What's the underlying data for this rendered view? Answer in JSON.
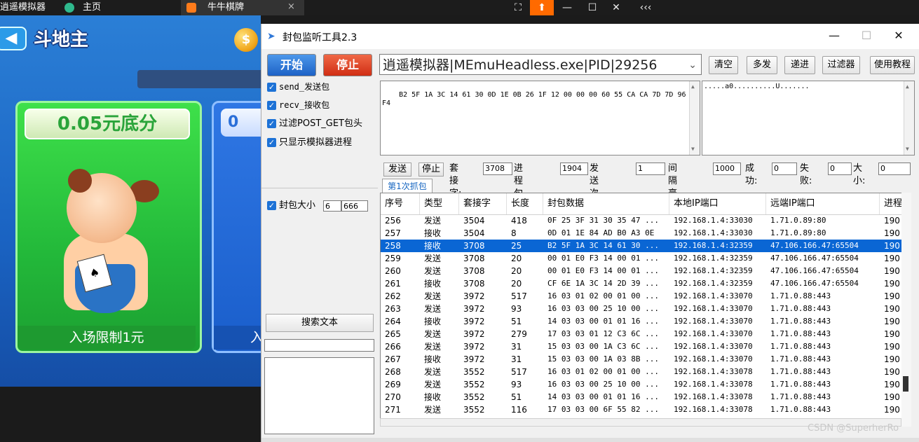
{
  "taskbar": {
    "tab1": "逍遥模拟器",
    "tab2": "主页",
    "tab3": "牛牛棋牌",
    "close_glyph": "×",
    "btn_fullscreen": "⛶",
    "btn_upload": "⬆",
    "btn_min": "—",
    "btn_max": "☐",
    "btn_close": "✕",
    "btn_more": "‹‹‹"
  },
  "game": {
    "title": "斗地主",
    "coin_glyph": "$",
    "card1_title": "0.05元底分",
    "card1_footer": "入场限制1元",
    "card2_title": "0",
    "card2_footer": "入"
  },
  "window": {
    "title": "封包监听工具2.3",
    "minimize": "—",
    "maximize": "☐",
    "close": "✕"
  },
  "controls": {
    "start": "开始",
    "stop": "停止",
    "chk_send": "send_发送包",
    "chk_recv": "recv_接收包",
    "chk_filter": "过滤POST_GET包头",
    "chk_emulator": "只显示模拟器进程",
    "chk_size": "封包大小",
    "size_min": "6",
    "size_max": "666",
    "search_text": "搜索文本"
  },
  "process": {
    "selected": "逍遥模拟器|MEmuHeadless.exe|PID|29256"
  },
  "toolbar": {
    "clear": "清空",
    "multi_send": "多发",
    "forward": "递进",
    "filter": "过滤器",
    "tutorial": "使用教程"
  },
  "packet_detail": {
    "hex": "B2 5F 1A 3C 14 61 30 0D 1E 0B 26 1F 12 00 00 00 60 55 CA CA 7D 7D 96 A2 F4",
    "ascii": ".....a0..........U......."
  },
  "send_row": {
    "send": "发送",
    "stop": "停止",
    "socket_label": "套接字:",
    "socket_val": "3708",
    "handle_label": "进程句柄:",
    "handle_val": "1904",
    "count_label": "发送次数:",
    "count_val": "1",
    "interval_label": "间隔毫秒:",
    "interval_val": "1000",
    "success_label": "成功:",
    "success_val": "0",
    "fail_label": "失败:",
    "fail_val": "0",
    "size_label": "大小:",
    "size_val": "0"
  },
  "capture_tab": "第1次抓包",
  "table": {
    "headers": [
      "序号",
      "类型",
      "套接字",
      "长度",
      "封包数据",
      "本地IP端口",
      "远端IP端口",
      "进程"
    ],
    "rows": [
      [
        "256",
        "发送",
        "3504",
        "418",
        "0F 25 3F 31 30 35 47 ...",
        "192.168.1.4:33030",
        "1.71.0.89:80",
        "190"
      ],
      [
        "257",
        "接收",
        "3504",
        "8",
        "0D 01 1E 84 AD B0 A3 0E",
        "192.168.1.4:33030",
        "1.71.0.89:80",
        "190"
      ],
      [
        "258",
        "接收",
        "3708",
        "25",
        "B2 5F 1A 3C 14 61 30 ...",
        "192.168.1.4:32359",
        "47.106.166.47:65504",
        "190"
      ],
      [
        "259",
        "发送",
        "3708",
        "20",
        "00 01 E0 F3 14 00 01 ...",
        "192.168.1.4:32359",
        "47.106.166.47:65504",
        "190"
      ],
      [
        "260",
        "发送",
        "3708",
        "20",
        "00 01 E0 F3 14 00 01 ...",
        "192.168.1.4:32359",
        "47.106.166.47:65504",
        "190"
      ],
      [
        "261",
        "接收",
        "3708",
        "20",
        "CF 6E 1A 3C 14 2D 39 ...",
        "192.168.1.4:32359",
        "47.106.166.47:65504",
        "190"
      ],
      [
        "262",
        "发送",
        "3972",
        "517",
        "16 03 01 02 00 01 00 ...",
        "192.168.1.4:33070",
        "1.71.0.88:443",
        "190"
      ],
      [
        "263",
        "发送",
        "3972",
        "93",
        "16 03 03 00 25 10 00 ...",
        "192.168.1.4:33070",
        "1.71.0.88:443",
        "190"
      ],
      [
        "264",
        "接收",
        "3972",
        "51",
        "14 03 03 00 01 01 16 ...",
        "192.168.1.4:33070",
        "1.71.0.88:443",
        "190"
      ],
      [
        "265",
        "发送",
        "3972",
        "279",
        "17 03 03 01 12 C3 6C ...",
        "192.168.1.4:33070",
        "1.71.0.88:443",
        "190"
      ],
      [
        "266",
        "发送",
        "3972",
        "31",
        "15 03 03 00 1A C3 6C ...",
        "192.168.1.4:33070",
        "1.71.0.88:443",
        "190"
      ],
      [
        "267",
        "接收",
        "3972",
        "31",
        "15 03 03 00 1A 03 8B ...",
        "192.168.1.4:33070",
        "1.71.0.88:443",
        "190"
      ],
      [
        "268",
        "发送",
        "3552",
        "517",
        "16 03 01 02 00 01 00 ...",
        "192.168.1.4:33078",
        "1.71.0.88:443",
        "190"
      ],
      [
        "269",
        "发送",
        "3552",
        "93",
        "16 03 03 00 25 10 00 ...",
        "192.168.1.4:33078",
        "1.71.0.88:443",
        "190"
      ],
      [
        "270",
        "接收",
        "3552",
        "51",
        "14 03 03 00 01 01 16 ...",
        "192.168.1.4:33078",
        "1.71.0.88:443",
        "190"
      ],
      [
        "271",
        "发送",
        "3552",
        "116",
        "17 03 03 00 6F 55 82 ...",
        "192.168.1.4:33078",
        "1.71.0.88:443",
        "190"
      ]
    ],
    "selected_index": 2
  },
  "watermark": "CSDN @SuperherRo"
}
